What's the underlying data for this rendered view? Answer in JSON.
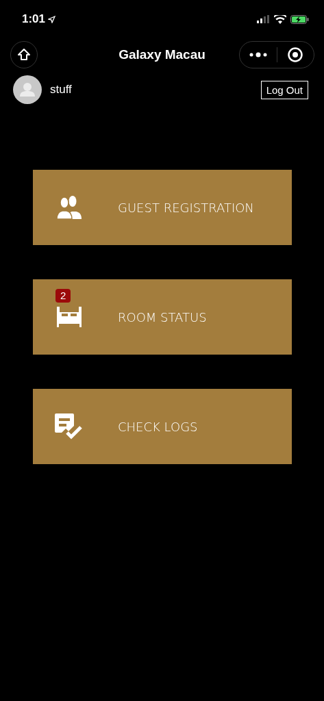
{
  "status_bar": {
    "time": "1:01"
  },
  "nav_bar": {
    "title": "Galaxy Macau"
  },
  "user": {
    "name": "stuff",
    "logout": "Log Out"
  },
  "menu": [
    {
      "label": "GUEST REGISTRATION",
      "kind": "guests"
    },
    {
      "label": "ROOM STATUS",
      "kind": "bed",
      "badge": "2"
    },
    {
      "label": "CHECK LOGS",
      "kind": "logs"
    }
  ]
}
